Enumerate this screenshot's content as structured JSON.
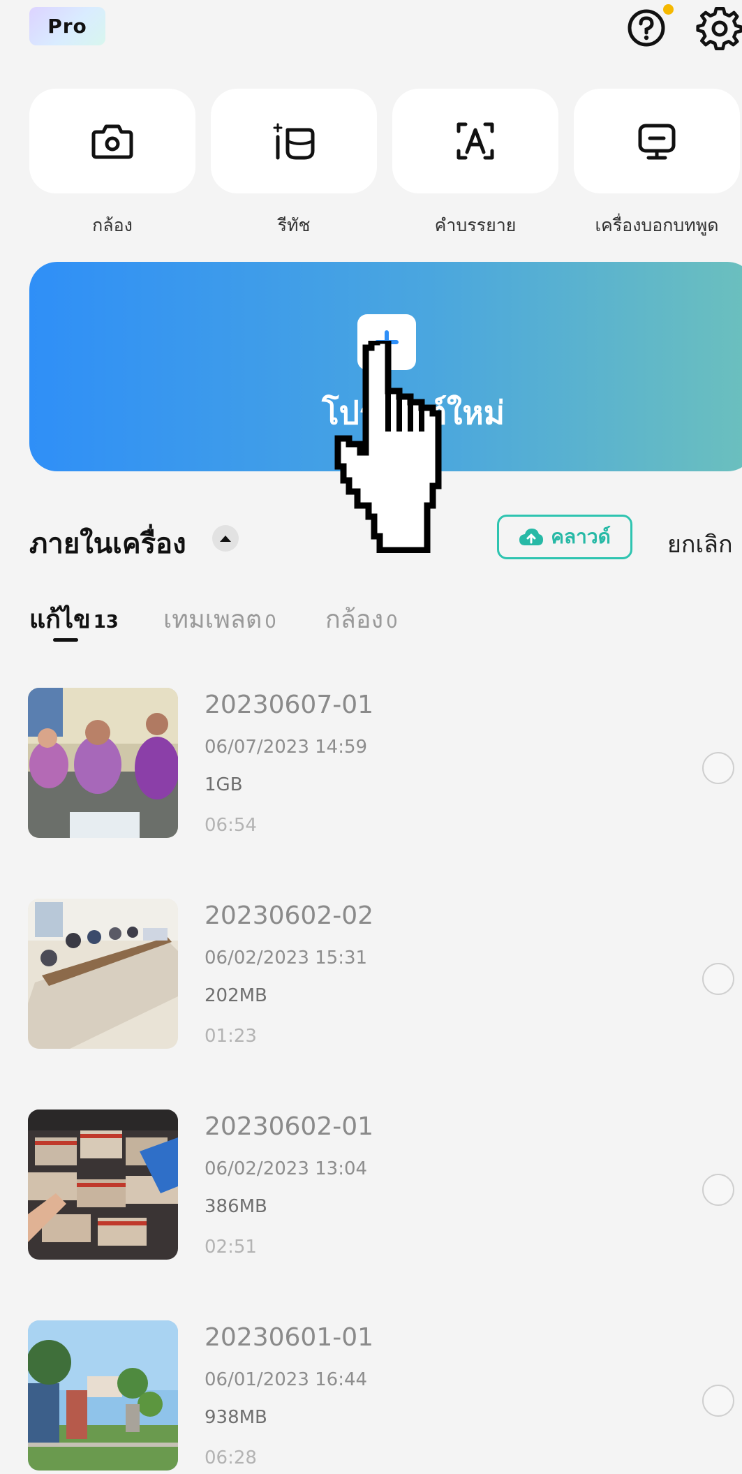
{
  "header": {
    "pro_badge": "Pro",
    "help_icon": "help-circle-icon",
    "notification_dot_color": "#f5b800",
    "settings_icon": "gear-icon"
  },
  "tools": [
    {
      "label": "กล้อง",
      "icon": "camera-icon"
    },
    {
      "label": "รีทัช",
      "icon": "retouch-icon"
    },
    {
      "label": "คำบรรยาย",
      "icon": "captions-icon"
    },
    {
      "label": "เครื่องบอกบทพูด",
      "icon": "teleprompter-icon"
    }
  ],
  "banner": {
    "label": "โปรเจกต์ใหม่",
    "icon": "plus-icon",
    "gradient": [
      "#2f8ff7",
      "#6cc0bd"
    ]
  },
  "cursor": {
    "icon": "hand-pointer-icon"
  },
  "section": {
    "title": "ภายในเครื่อง",
    "toggle_icon": "caret-up-icon",
    "cloud_label": "คลาวด์",
    "cloud_icon": "cloud-upload-icon",
    "accent": "#2ec4b0",
    "cancel_label": "ยกเลิก"
  },
  "tabs": [
    {
      "label": "แก้ไข",
      "count": "13",
      "active": true
    },
    {
      "label": "เทมเพลต",
      "count": "0",
      "active": false
    },
    {
      "label": "กล้อง",
      "count": "0",
      "active": false
    }
  ],
  "projects": [
    {
      "title": "20230607-01",
      "date": "06/07/2023 14:59",
      "size": "1GB",
      "duration": "06:54"
    },
    {
      "title": "20230602-02",
      "date": "06/02/2023 15:31",
      "size": "202MB",
      "duration": "01:23"
    },
    {
      "title": "20230602-01",
      "date": "06/02/2023 13:04",
      "size": "386MB",
      "duration": "02:51"
    },
    {
      "title": "20230601-01",
      "date": "06/01/2023 16:44",
      "size": "938MB",
      "duration": "06:28"
    }
  ]
}
